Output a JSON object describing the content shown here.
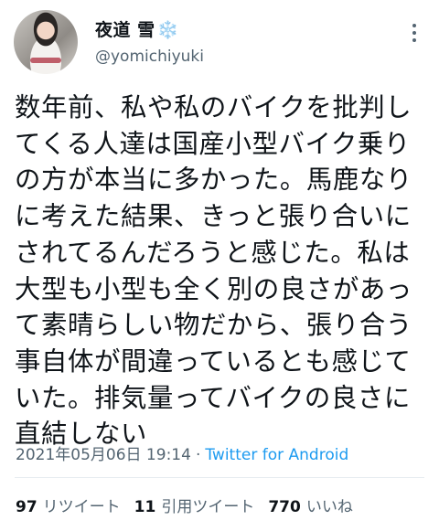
{
  "user": {
    "display_name": "夜道 雪",
    "emoji": "❄️",
    "handle": "@yomichiyuki"
  },
  "tweet": {
    "text": "数年前、私や私のバイクを批判し\nてくる人達は国産小型バイク乗り\nの方が本当に多かった。馬鹿なり\nに考えた結果、きっと張り合いに\nされてるんだろうと感じた。私は\n大型も小型も全く別の良さがあっ\nて素晴らしい物だから、張り合う\n事自体が間違っているとも感じて\nいた。排気量ってバイクの良さに\n直結しない",
    "timestamp": "2021年05月06日 19:14",
    "separator": "·",
    "source": "Twitter for Android"
  },
  "stats": {
    "retweets_count": "97",
    "retweets_label": "リツイート",
    "quotes_count": "11",
    "quotes_label": "引用ツイート",
    "likes_count": "770",
    "likes_label": "いいね"
  },
  "icons": {
    "more": "more-vertical-icon"
  },
  "colors": {
    "text": "#0f1419",
    "secondary": "#536471",
    "link": "#1d9bf0"
  }
}
